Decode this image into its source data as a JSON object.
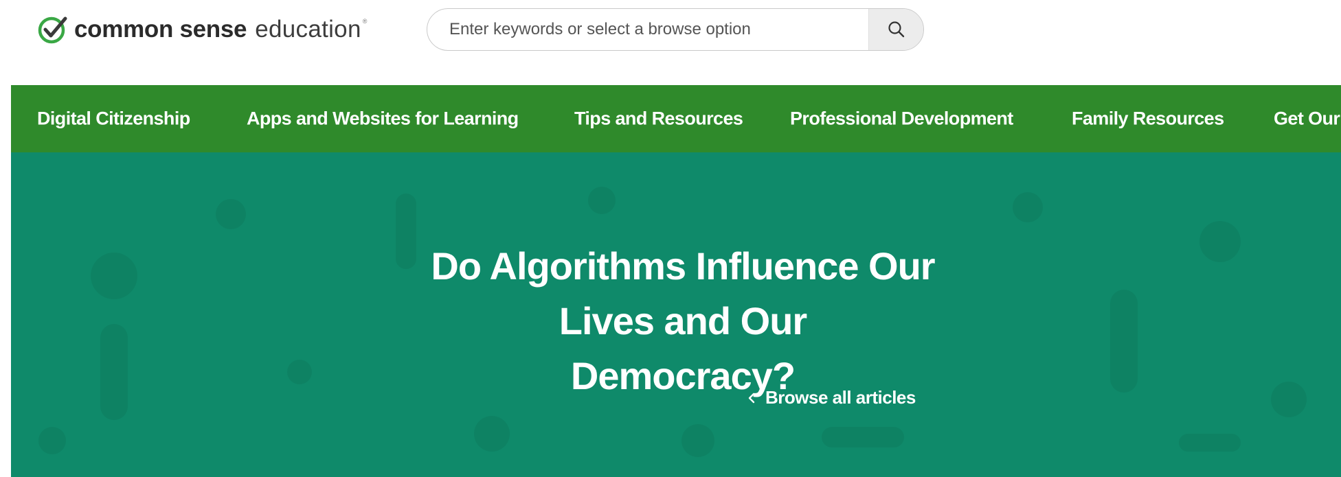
{
  "brand": {
    "name_bold": "common sense",
    "name_light": "education",
    "trademark": "®",
    "logo_icon": "check-circle-icon",
    "colors": {
      "logo_green": "#3aa845",
      "nav_green": "#2f8a2b",
      "hero_teal": "#0f8a6a"
    }
  },
  "search": {
    "placeholder": "Enter keywords or select a browse option",
    "value": "",
    "button_icon": "search-icon"
  },
  "nav": {
    "items": [
      {
        "label": "Digital Citizenship"
      },
      {
        "label": "Apps and Websites for Learning"
      },
      {
        "label": "Tips and Resources"
      },
      {
        "label": "Professional Development"
      },
      {
        "label": "Family Resources"
      },
      {
        "label": "Get Our"
      }
    ]
  },
  "hero": {
    "title_line1": "Do Algorithms Influence Our Lives and Our",
    "title_line2": "Democracy?",
    "browse_link": "Browse all articles",
    "browse_icon": "chevron-left-icon"
  }
}
